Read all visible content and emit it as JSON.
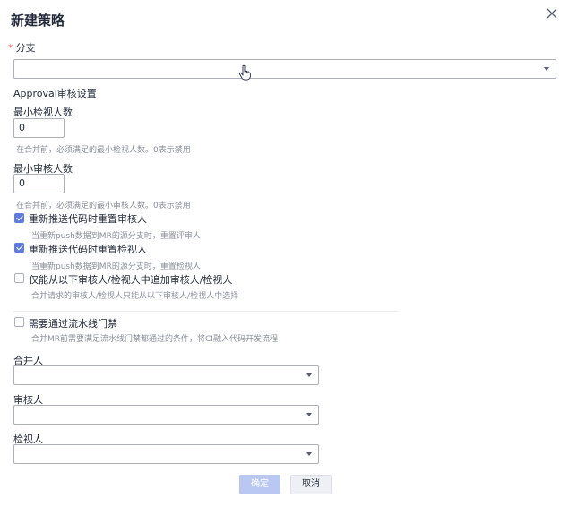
{
  "dialog": {
    "title": "新建策略",
    "close_icon": "close-icon"
  },
  "branch": {
    "label": "分支",
    "required_mark": "*",
    "value": ""
  },
  "approval": {
    "section_label": "Approval审核设置",
    "min_reviewers": {
      "label": "最小检视人数",
      "value": "0",
      "hint": "在合并前，必须满足的最小检视人数。0表示禁用"
    },
    "min_approvers": {
      "label": "最小审核人数",
      "value": "0",
      "hint": "在合并前，必须满足的最小审核人数。0表示禁用"
    },
    "options": [
      {
        "label": "重新推送代码时重置审核人",
        "hint": "当重新push数据到MR的源分支时，重置评审人",
        "checked": true
      },
      {
        "label": "重新推送代码时重置检视人",
        "hint": "当重新push数据到MR的源分支时，重置检视人",
        "checked": true
      },
      {
        "label": "仅能从以下审核人/检视人中追加审核人/检视人",
        "hint": "合并请求的审核人/检视人只能从以下审核人/检视人中选择",
        "checked": false
      }
    ]
  },
  "pipeline_gate": {
    "label": "需要通过流水线门禁",
    "hint": "合并MR前需要满足流水线门禁都通过的条件，将CI融入代码开发流程",
    "checked": false
  },
  "selects": {
    "merger": {
      "label": "合并人",
      "value": ""
    },
    "approver": {
      "label": "审核人",
      "value": ""
    },
    "reviewer": {
      "label": "检视人",
      "value": ""
    }
  },
  "footer": {
    "confirm_label": "确定",
    "cancel_label": "取消"
  },
  "colors": {
    "primary": "#5e7ce0",
    "primary_disabled": "#b8c8f2",
    "required": "#f66f6a",
    "hint": "#8a8e99"
  }
}
